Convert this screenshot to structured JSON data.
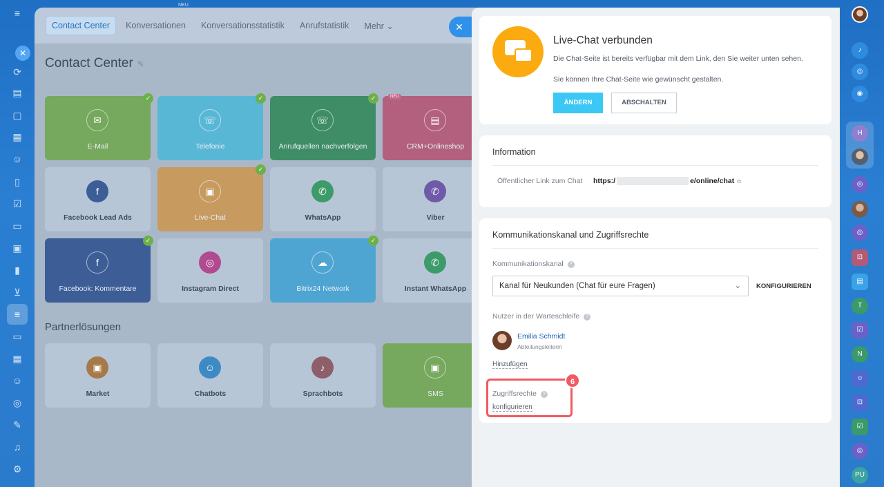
{
  "top_badge": "NEU",
  "topnav": {
    "tabs": [
      "Contact Center",
      "Konversationen",
      "Konversationsstatistik",
      "Anrufstatistik",
      "Mehr ⌄"
    ]
  },
  "page": {
    "title": "Contact Center",
    "tiles": [
      {
        "label": "E-Mail",
        "icon": "✉",
        "color": "#76a85d"
      },
      {
        "label": "Telefonie",
        "icon": "☏",
        "color": "#59b7d6"
      },
      {
        "label": "Anrufquellen nachverfolgen",
        "icon": "☏",
        "color": "#3e8d66"
      },
      {
        "label": "CRM+Onlineshop",
        "icon": "▤",
        "color": "#b2607d",
        "badge": "NEU"
      },
      {
        "label": "Facebook Lead Ads",
        "icon": "f",
        "color": "#b7c6d6"
      },
      {
        "label": "Live-Chat",
        "icon": "▣",
        "color": "#c79a60"
      },
      {
        "label": "WhatsApp",
        "icon": "✆",
        "color": "#b7c6d6"
      },
      {
        "label": "Viber",
        "icon": "✆",
        "color": "#b7c6d6"
      },
      {
        "label": "Facebook: Kommentare",
        "icon": "f",
        "color": "#3c5d96"
      },
      {
        "label": "Instagram Direct",
        "icon": "◎",
        "color": "#b7c6d6"
      },
      {
        "label": "Bitrix24 Network",
        "icon": "☁",
        "color": "#4fa5d2"
      },
      {
        "label": "Instant WhatsApp",
        "icon": "✆",
        "color": "#b7c6d6"
      }
    ],
    "partner_title": "Partnerlösungen",
    "partners": [
      {
        "label": "Market",
        "icon": "▣",
        "color": "#b7c6d6"
      },
      {
        "label": "Chatbots",
        "icon": "☺",
        "color": "#b7c6d6"
      },
      {
        "label": "Sprachbots",
        "icon": "♪",
        "color": "#b7c6d6"
      },
      {
        "label": "SMS",
        "icon": "▣",
        "color": "#76a85d"
      }
    ]
  },
  "slider": {
    "connected_title": "Live-Chat verbunden",
    "connected_text1": "Die Chat-Seite ist bereits verfügbar mit dem Link, den Sie weiter unten sehen.",
    "connected_text2": "Sie können Ihre Chat-Seite wie gewünscht gestalten.",
    "btn_change": "ÄNDERN",
    "btn_disable": "ABSCHALTEN",
    "info_title": "Information",
    "public_link_label": "Öffentlicher Link zum Chat",
    "public_link_prefix": "https:/",
    "public_link_suffix": "e/online/chat",
    "channel_section_title": "Kommunikationskanal und Zugriffsrechte",
    "channel_label": "Kommunikationskanal",
    "channel_value": "Kanal für Neukunden (Chat für eure Fragen)",
    "configure_label": "KONFIGURIEREN",
    "queue_label": "Nutzer in der Warteschleife",
    "user_name": "Emilia Schmidt",
    "user_position": "Abteilungsleiterin",
    "add_link": "Hinzufügen",
    "rights_label": "Zugriffsrechte",
    "rights_link": "konfigurieren",
    "step_number": "6"
  },
  "right_rail": {
    "items": [
      "H",
      "T",
      "N",
      "PU"
    ]
  },
  "colors": {
    "accent": "#3bc8f5",
    "highlight": "#f05a62",
    "livechat_orange": "#fbaa10"
  }
}
